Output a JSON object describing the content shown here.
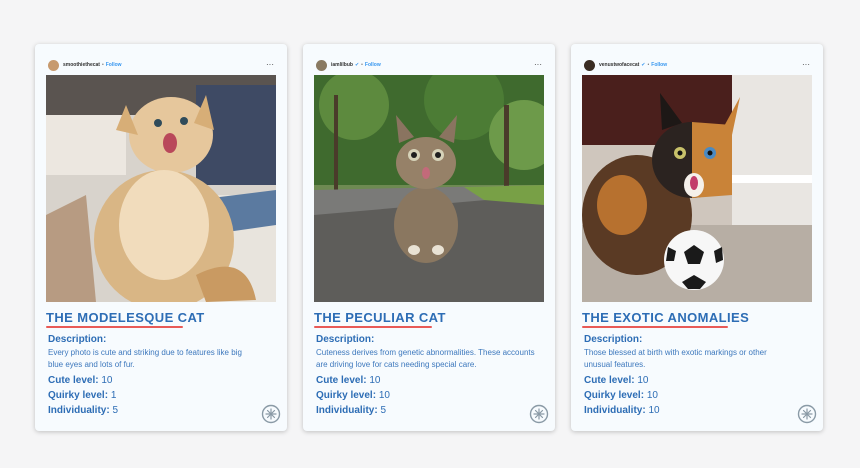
{
  "cards": [
    {
      "username": "smoothiethecat",
      "verified": false,
      "follow": "Follow",
      "avatar_color": "#c79a6e",
      "photo_subject": "fluffy long-haired cream cat with open mouth on a bed",
      "title": "THE MODELESQUE CAT",
      "description_label": "Description:",
      "description": "Every photo is cute and striking due to features like big blue eyes and lots of fur.",
      "stats": [
        {
          "label": "Cute level:",
          "value": "10"
        },
        {
          "label": "Quirky level:",
          "value": "1"
        },
        {
          "label": "Individuality:",
          "value": "5"
        }
      ]
    },
    {
      "username": "iamlilbub",
      "verified": true,
      "follow": "Follow",
      "avatar_color": "#8a7a62",
      "photo_subject": "tabby cat with tongue out walking on a gravel path in a forest",
      "title": "THE PECULIAR CAT",
      "description_label": "Description:",
      "description": "Cuteness derives from genetic abnormalities. These accounts are driving love for cats needing special care.",
      "stats": [
        {
          "label": "Cute level:",
          "value": "10"
        },
        {
          "label": "Quirky level:",
          "value": "10"
        },
        {
          "label": "Individuality:",
          "value": "5"
        }
      ]
    },
    {
      "username": "venustwofacecat",
      "verified": true,
      "follow": "Follow",
      "avatar_color": "#3a2c22",
      "photo_subject": "two-faced black and orange cat with a soccer ball",
      "title": "THE EXOTIC ANOMALIES",
      "description_label": "Description:",
      "description": "Those blessed at birth with exotic markings or other unusual features.",
      "stats": [
        {
          "label": "Cute level:",
          "value": "10"
        },
        {
          "label": "Quirky level:",
          "value": "10"
        },
        {
          "label": "Individuality:",
          "value": "10"
        }
      ]
    }
  ],
  "more_icon": "ellipsis-icon",
  "badge_icon": "cat-paw-badge-icon",
  "colors": {
    "title": "#2d6db5",
    "underline": "#e85a57",
    "card_bg": "#f7fbfe",
    "page_bg": "#f5f5f6"
  }
}
